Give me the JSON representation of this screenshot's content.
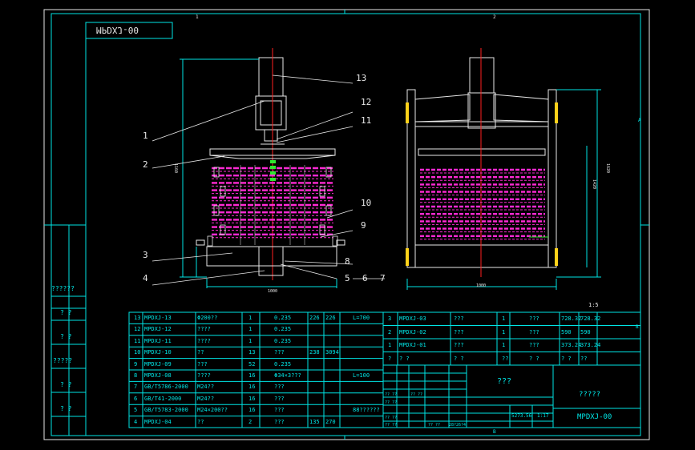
{
  "title_box": "MPDXJ-00",
  "zone_marks": {
    "top_left": "1",
    "top_right": "2",
    "bottom": "B",
    "side_a": "A",
    "side_b": "B"
  },
  "balloons": [
    "1",
    "2",
    "3",
    "4",
    "5",
    "6",
    "7",
    "8",
    "9",
    "10",
    "11",
    "12",
    "13"
  ],
  "left_stack": [
    "??????",
    "? ?",
    "? ?",
    "?????",
    "? ?",
    "? ?"
  ],
  "note_ratio": "1:5",
  "bom_left": [
    [
      "13",
      "MPDXJ-13",
      "Φ200??",
      "1",
      "0.235",
      "226",
      "226",
      "L=700"
    ],
    [
      "12",
      "MPDXJ-12",
      "????",
      "1",
      "0.235",
      "",
      "",
      ""
    ],
    [
      "11",
      "MPDXJ-11",
      "????",
      "1",
      "0.235",
      "",
      "",
      ""
    ],
    [
      "10",
      "MPDXJ-10",
      "??",
      "13",
      "???",
      "238",
      "3094",
      ""
    ],
    [
      "9",
      "MPDXJ-09",
      "???",
      "52",
      "0.235",
      "",
      "",
      ""
    ],
    [
      "8",
      "MPDXJ-08",
      "????",
      "16",
      "Φ34×3???",
      "",
      "",
      "L=100"
    ],
    [
      "7",
      "GB/T5786-2000",
      "M24??",
      "16",
      "???",
      "",
      "",
      ""
    ],
    [
      "6",
      "GB/T41-2000",
      "M24??",
      "16",
      "???",
      "",
      "",
      ""
    ],
    [
      "5",
      "GB/T5783-2000",
      "M24×200??",
      "16",
      "???",
      "",
      "",
      "88??????"
    ],
    [
      "4",
      "MPDXJ-04",
      "??",
      "2",
      "???",
      "135",
      "270",
      ""
    ]
  ],
  "bom_right": [
    [
      "3",
      "MPDXJ-03",
      "???",
      "1",
      "???",
      "728.32",
      "728.32"
    ],
    [
      "2",
      "MPDXJ-02",
      "???",
      "1",
      "???",
      "590",
      "590"
    ],
    [
      "1",
      "MPDXJ-01",
      "???",
      "1",
      "???",
      "373.24",
      "373.24"
    ]
  ],
  "bom_right_header": [
    "?",
    "? ?",
    "? ?",
    "??",
    "? ?",
    "? ?",
    "??"
  ],
  "title_block": {
    "name": "???",
    "company": "?????",
    "drawing_no": "MPDXJ-00",
    "scale": "1:17",
    "weight": "5273.56",
    "small_rows": [
      "?? ??",
      "?? ??",
      "?? ??",
      "?? ??",
      "?? ??",
      "?? ??"
    ],
    "sheet": "28?26?4"
  },
  "dimensions": {
    "front_width": "1000",
    "side_width": "1000",
    "side_height": "1620",
    "side_inner": "1420",
    "front_height": "1160"
  },
  "colors": {
    "frame": "#00e5e5",
    "white": "#e8e8e8",
    "magenta": "#ff2ad4",
    "red": "#ff2020",
    "green": "#2fe82f",
    "yellow": "#ffd21a"
  }
}
